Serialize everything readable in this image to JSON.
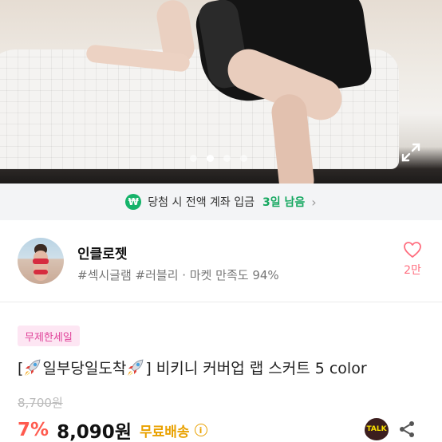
{
  "carousel": {
    "dot_count": 4,
    "active_index": 1
  },
  "banner": {
    "icon": "₩",
    "text": "당첨 시 전액 계좌 입금",
    "days_left": "3일 남음",
    "chevron": "›"
  },
  "seller": {
    "name": "인클로젯",
    "tags": "#섹시글램 #러블리 · 마켓 만족도 94%",
    "like_count": "2만"
  },
  "product": {
    "badge": "무제한세일",
    "title_open": "[",
    "title_mid": "일부당일도착",
    "title_close": "] 비키니 커버업 랩 스커트 5 color",
    "original_price": "8,700원",
    "discount": "7%",
    "price": "8,090원",
    "shipping": "무료배송",
    "info_icon": "i",
    "talk_label": "TALK"
  },
  "colors": {
    "accent_green": "#15b36a",
    "discount_red": "#ff5a4e",
    "shipping_gold": "#e9a100",
    "like_pink": "#ff6f80",
    "badge_pink": "#e0449a"
  }
}
